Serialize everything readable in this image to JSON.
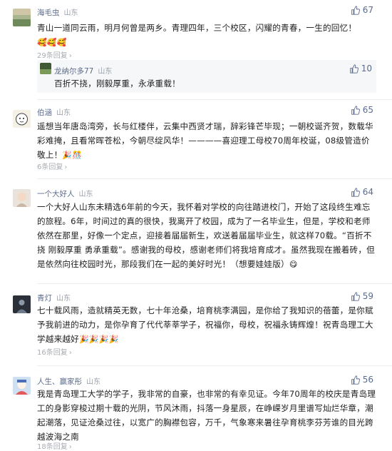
{
  "comments": [
    {
      "user": "海毛虫",
      "location": "山东",
      "likes": "67",
      "text": "青山一道同云雨，明月何曾是两乡。青理四年，三个校区，闪耀的青春，一生的回忆！",
      "emoji": "🥰🥰🥰",
      "replies": "29条回复",
      "reply": {
        "user": "龙纳尔多77",
        "location": "山东",
        "likes": "10",
        "text": "百折不挠，刚毅厚重，永承重载！"
      }
    },
    {
      "user": "伯涵",
      "location": "山东",
      "likes": "65",
      "text": "遥想当年唐岛湾旁，长与红楼伴，云集中西贤才瑞，辞彩锋芒毕现；一朝校诞齐贺，数载华彩难掩，且看常晖苍松，今朝尽绽风华！————喜迎理工母校70周年校诞，08级管造价敬上！",
      "emoji": "🎉🎊",
      "replies": "6条回复"
    },
    {
      "user": "一个大好人",
      "location": "山东",
      "likes": "64",
      "text": "一个大好人山东未精选6年前的今天，我怀着对学校的向往踏进校门，开始了这段终生难忘的旅程。6年，时间过的真的很快，我离开了校园，成为了一名毕业生，但是，学校和老师依然在那里，好像一个定点，迎接着届届新生，欢送着届届毕业生，就这样70载。“百折不挠 刚毅厚重 勇承重载”。感谢我的母校，感谢老师们将我培育成才。虽然我现在搬着砖，但是依然向往校园时光，那段我们在一起的美好时光！（想要娃娃版）",
      "emoji": "😋"
    },
    {
      "user": "青灯",
      "location": "山东",
      "likes": "59",
      "text": "七十载风雨，造就精英无数，七十年沧桑，培育桃李满园，是你给了我知识的蓓蕾，是你赋予我前进的动力，是你孕育了代代莘莘学子，祝福你，母校，祝福永铸辉煌！祝青岛理工大学越来越好",
      "emoji": "🎉🎉🎉🎉",
      "replies": "16条回复"
    },
    {
      "user": "人生、赢家彤",
      "location": "山东",
      "likes": "56",
      "text": "我是青岛理工大学的学子，我非常的自豪，也非常的有幸见证。今年70周年的校庆是青岛理工的身影穿梭过期十载的光阴，节风沐雨，抖落一身星辰，在峥嵘岁月里谱写灿烂华章，潮起潮落，见证沧桑过往，以宽广的胸襟包容，万千，气象寒来暑往孕育桃李芬芳谁的目光跨越波海之南",
      "replies": "18条回复"
    }
  ],
  "colors": {
    "name": "#5b6b8a",
    "text": "#222222",
    "muted": "#a8adb4"
  }
}
